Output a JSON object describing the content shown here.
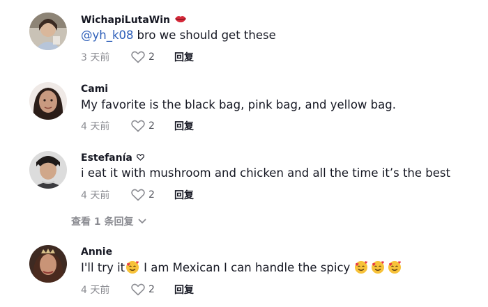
{
  "comments": [
    {
      "username": "WichapiLutaWin",
      "badge_icon": "lips-icon",
      "mention": "@yh_k08",
      "text": "bro we should get these",
      "time": "3 天前",
      "likes": "2",
      "reply_label": "回复"
    },
    {
      "username": "Cami",
      "text": "My favorite is the black bag, pink bag, and yellow bag.",
      "time": "4 天前",
      "likes": "2",
      "reply_label": "回复"
    },
    {
      "username": "Estefanía",
      "badge_icon": "heart-outline-icon",
      "text": "i eat it with mushroom and chicken and all the time it’s the best",
      "time": "4 天前",
      "likes": "2",
      "reply_label": "回复"
    },
    {
      "username": "Annie",
      "text_part1": "I'll try it",
      "text_part2": "I am Mexican I can handle the spicy",
      "time": "4 天前",
      "likes": "2",
      "reply_label": "回复"
    }
  ],
  "view_replies": "查看 1 条回复",
  "colors": {
    "mention": "#2b5db8",
    "text": "#161823",
    "muted": "#8a8b91"
  }
}
